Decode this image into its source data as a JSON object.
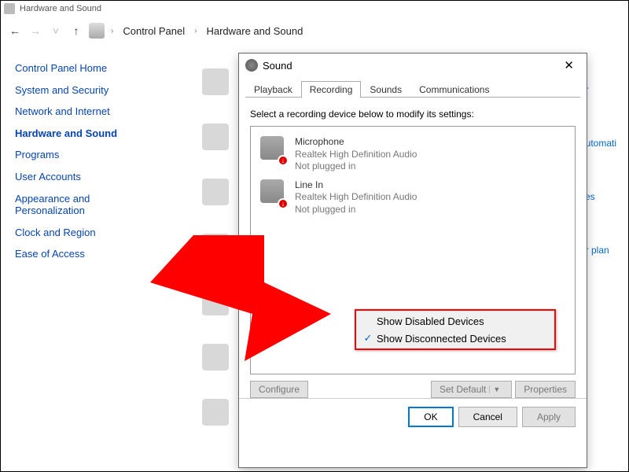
{
  "title_bar": "Hardware and Sound",
  "breadcrumb": {
    "root": "Control Panel",
    "current": "Hardware and Sound"
  },
  "sidebar_links": [
    {
      "label": "Control Panel Home",
      "active": false
    },
    {
      "label": "System and Security",
      "active": false
    },
    {
      "label": "Network and Internet",
      "active": false
    },
    {
      "label": "Hardware and Sound",
      "active": true
    },
    {
      "label": "Programs",
      "active": false
    },
    {
      "label": "User Accounts",
      "active": false
    },
    {
      "label": "Appearance and Personalization",
      "active": false
    },
    {
      "label": "Clock and Region",
      "active": false
    },
    {
      "label": "Ease of Access",
      "active": false
    }
  ],
  "bg_link_texts": [
    "er",
    "automati",
    "ces",
    "er plan"
  ],
  "dialog": {
    "title": "Sound",
    "tabs": [
      {
        "label": "Playback",
        "active": false
      },
      {
        "label": "Recording",
        "active": true
      },
      {
        "label": "Sounds",
        "active": false
      },
      {
        "label": "Communications",
        "active": false
      }
    ],
    "instruction": "Select a recording device below to modify its settings:",
    "devices": [
      {
        "name": "Microphone",
        "desc": "Realtek High Definition Audio",
        "status": "Not plugged in"
      },
      {
        "name": "Line In",
        "desc": "Realtek High Definition Audio",
        "status": "Not plugged in"
      }
    ],
    "context_menu": [
      {
        "label": "Show Disabled Devices",
        "checked": false
      },
      {
        "label": "Show Disconnected Devices",
        "checked": true
      }
    ],
    "buttons": {
      "configure": "Configure",
      "set_default": "Set Default",
      "properties": "Properties",
      "ok": "OK",
      "cancel": "Cancel",
      "apply": "Apply"
    }
  },
  "colors": {
    "highlight": "red",
    "link": "#0645ad"
  }
}
